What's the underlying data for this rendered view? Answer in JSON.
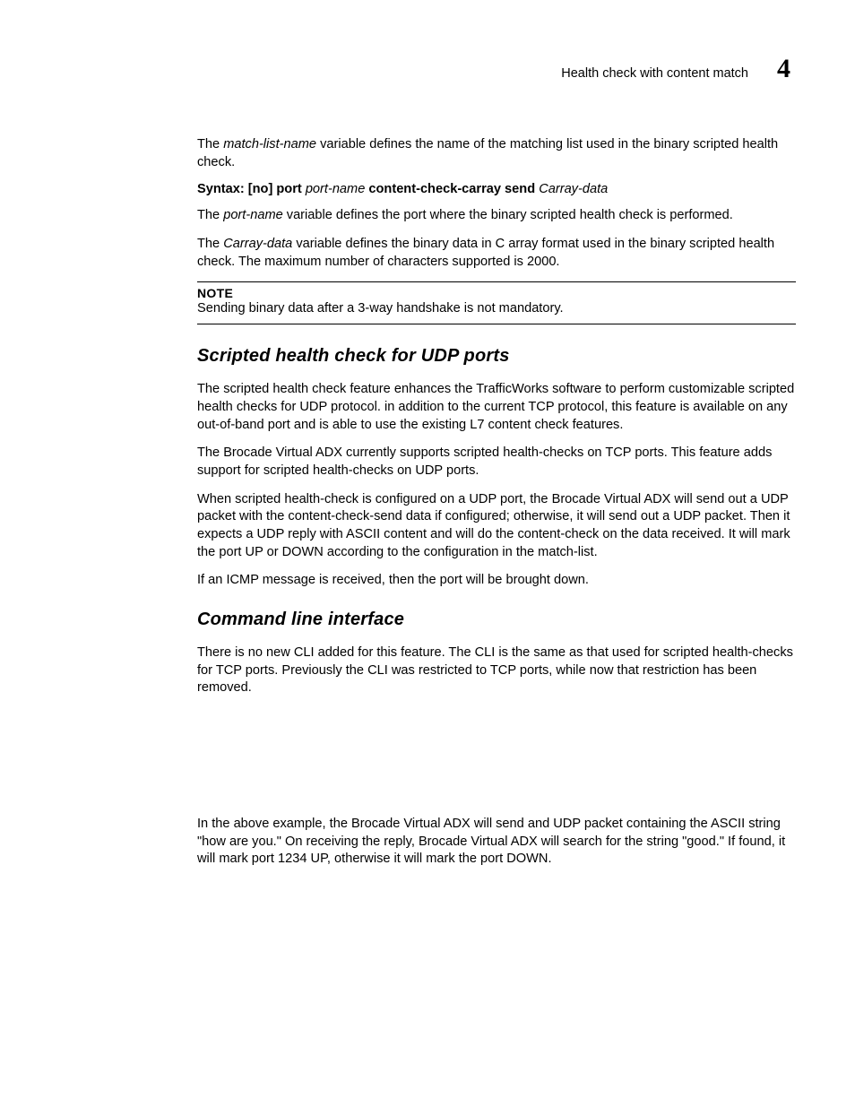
{
  "header": {
    "title": "Health check with content match",
    "chapter_number": "4"
  },
  "body": {
    "p1_a": "The ",
    "p1_b": "match-list-name",
    "p1_c": " variable defines the name of the matching list used in the binary scripted health check.",
    "syntax": {
      "label": "Syntax:",
      "part1": " [no] port ",
      "part2": "port-name",
      "part3": " content-check-carray send ",
      "part4": "Carray-data"
    },
    "p2_a": "The ",
    "p2_b": "port-name",
    "p2_c": " variable defines the port where the binary scripted health check is performed.",
    "p3_a": "The ",
    "p3_b": "Carray-data",
    "p3_c": " variable defines the binary data in C array format used in the binary scripted health check. The maximum number of characters supported is 2000.",
    "note": {
      "label": "NOTE",
      "text": "Sending binary data after a 3-way handshake is not mandatory."
    },
    "h1": "Scripted health check for UDP ports",
    "p4": "The scripted health check feature enhances the TrafficWorks software to perform customizable scripted health checks for UDP protocol. in addition to the current TCP protocol, this feature is available on any out-of-band port and is able to use the existing L7 content check features.",
    "p5": "The Brocade Virtual ADX currently supports scripted health-checks on TCP ports. This feature adds support for scripted health-checks on UDP ports.",
    "p6": "When scripted health-check is configured on a UDP port, the Brocade Virtual ADX will send out a UDP packet with the content-check-send data if configured; otherwise, it will send out a UDP packet. Then it expects a UDP reply with ASCII content and will do the content-check on the data received. It will mark the port UP or DOWN according to the configuration in the match-list.",
    "p7": "If an ICMP message is received, then the port will be brought down.",
    "h2": "Command line interface",
    "p8": "There is no new CLI added for this feature. The CLI is the same as that used for scripted health-checks for TCP ports. Previously the CLI was restricted to TCP ports, while now that restriction has been removed.",
    "p9": "In the above example, the Brocade Virtual ADX will send and UDP packet containing the ASCII string \"how are you.\" On receiving the reply, Brocade Virtual ADX will search for the string \"good.\" If found, it will mark port 1234 UP, otherwise it will mark the port DOWN."
  }
}
